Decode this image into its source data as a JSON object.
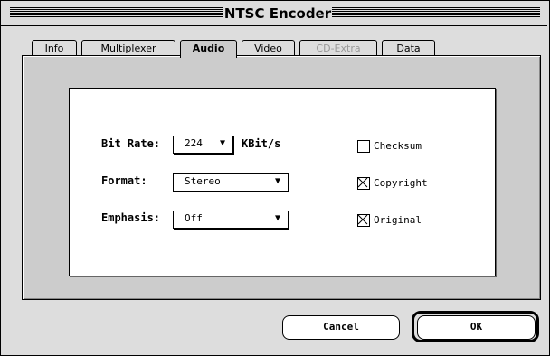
{
  "window": {
    "title": "NTSC Encoder"
  },
  "tabs": [
    {
      "label": "Info",
      "state": "normal"
    },
    {
      "label": "Multiplexer",
      "state": "normal"
    },
    {
      "label": "Audio",
      "state": "active"
    },
    {
      "label": "Video",
      "state": "normal"
    },
    {
      "label": "CD-Extra",
      "state": "disabled"
    },
    {
      "label": "Data",
      "state": "normal"
    }
  ],
  "audio": {
    "bit_rate": {
      "label": "Bit Rate:",
      "value": "224",
      "unit": "KBit/s"
    },
    "format": {
      "label": "Format:",
      "value": "Stereo"
    },
    "emphasis": {
      "label": "Emphasis:",
      "value": "Off"
    },
    "checkboxes": [
      {
        "label": "Checksum",
        "checked": false
      },
      {
        "label": "Copyright",
        "checked": true
      },
      {
        "label": "Original",
        "checked": true
      }
    ]
  },
  "buttons": {
    "cancel": "Cancel",
    "ok": "OK"
  },
  "icons": {
    "dropdown": "▼"
  }
}
